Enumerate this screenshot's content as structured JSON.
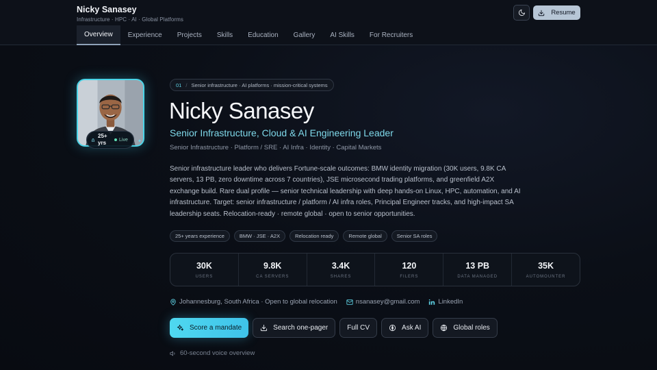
{
  "header": {
    "brand_name": "Nicky Sanasey",
    "brand_tagline": "Infrastructure · HPC · AI · Global Platforms",
    "resume_label": "Resume",
    "theme_icon": "moon-icon",
    "tabs": [
      {
        "label": "Overview",
        "active": true
      },
      {
        "label": "Experience"
      },
      {
        "label": "Projects"
      },
      {
        "label": "Skills"
      },
      {
        "label": "Education"
      },
      {
        "label": "Gallery"
      },
      {
        "label": "AI Skills"
      },
      {
        "label": "For Recruiters"
      }
    ]
  },
  "profile": {
    "badge_years_line1": "25+",
    "badge_years_line2": "yrs",
    "badge_live": "Live"
  },
  "hero": {
    "crumb_number": "01",
    "crumb_separator": "/",
    "crumb_text": "Senior infrastructure · AI platforms · mission-critical systems",
    "name": "Nicky Sanasey",
    "role": "Senior Infrastructure, Cloud & AI Engineering Leader",
    "areas": "Senior Infrastructure · Platform / SRE · AI Infra · Identity · Capital Markets",
    "summary": "Senior infrastructure leader who delivers Fortune-scale outcomes: BMW identity migration (30K users, 9.8K CA servers, 13 PB, zero downtime across 7 countries), JSE microsecond trading platforms, and greenfield A2X exchange build. Rare dual profile — senior technical leadership with deep hands-on Linux, HPC, automation, and AI infrastructure. Target: senior infrastructure / platform / AI infra roles, Principal Engineer tracks, and high-impact SA leadership seats. Relocation-ready · remote global · open to senior opportunities.",
    "chips": [
      "25+ years experience",
      "BMW · JSE · A2X",
      "Relocation ready",
      "Remote global",
      "Senior SA roles"
    ]
  },
  "stats": [
    {
      "value": "30K",
      "label": "Users"
    },
    {
      "value": "9.8K",
      "label": "CA Servers"
    },
    {
      "value": "3.4K",
      "label": "Shares"
    },
    {
      "value": "120",
      "label": "Filers"
    },
    {
      "value": "13 PB",
      "label": "Data Managed"
    },
    {
      "value": "35K",
      "label": "Automounter"
    }
  ],
  "contacts": {
    "location": "Johannesburg, South Africa · Open to global relocation",
    "email": "nsanasey@gmail.com",
    "linkedin": "LinkedIn"
  },
  "actions": {
    "score": "Score a mandate",
    "search": "Search one-pager",
    "cv": "Full CV",
    "ask": "Ask AI",
    "global": "Global roles"
  },
  "voice": "60-second voice overview",
  "colors": {
    "accent": "#4fd8f0",
    "role_text": "#7fd9ea",
    "background": "#0b0f17",
    "resume_button": "#b7c6d6"
  }
}
